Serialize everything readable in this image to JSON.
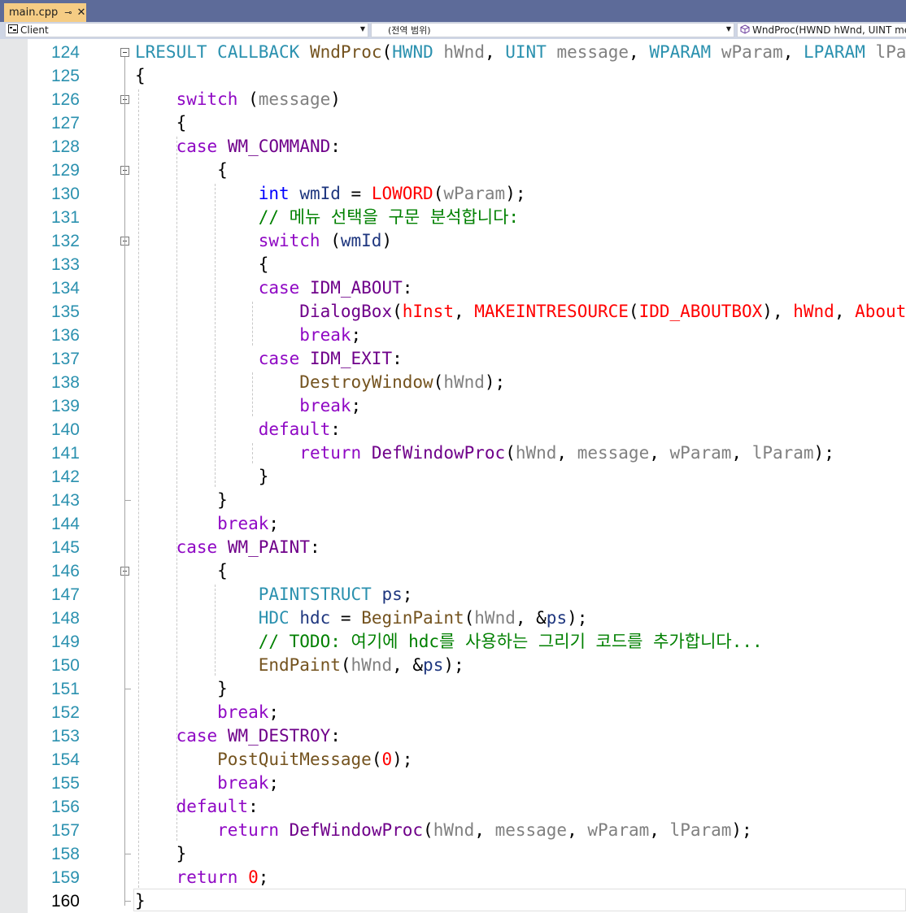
{
  "tab": {
    "title": "main.cpp",
    "pin_glyph": "⊸",
    "close_glyph": "✕"
  },
  "navbar": {
    "project": "Client",
    "scope": "(전역 범위)",
    "member": "WndProc(HWND hWnd, UINT mes"
  },
  "editor": {
    "current_line": 160,
    "lines": [
      {
        "n": 124,
        "tokens": [
          [
            "LRESULT",
            "type"
          ],
          [
            " ",
            ""
          ],
          [
            "CALLBACK",
            "type"
          ],
          [
            " ",
            ""
          ],
          [
            "WndProc",
            "fn"
          ],
          [
            "(",
            ""
          ],
          [
            "HWND",
            "type"
          ],
          [
            " ",
            ""
          ],
          [
            "hWnd",
            "param"
          ],
          [
            ", ",
            ""
          ],
          [
            "UINT",
            "type"
          ],
          [
            " ",
            ""
          ],
          [
            "message",
            "param"
          ],
          [
            ", ",
            ""
          ],
          [
            "WPARAM",
            "type"
          ],
          [
            " ",
            ""
          ],
          [
            "wParam",
            "param"
          ],
          [
            ", ",
            ""
          ],
          [
            "LPARAM",
            "type"
          ],
          [
            " ",
            ""
          ],
          [
            "lParam",
            "param"
          ],
          [
            ")",
            ""
          ]
        ]
      },
      {
        "n": 125,
        "tokens": [
          [
            "{",
            ""
          ]
        ]
      },
      {
        "n": 126,
        "tokens": [
          [
            "    ",
            ""
          ],
          [
            "switch",
            "kw"
          ],
          [
            " (",
            ""
          ],
          [
            "message",
            "param"
          ],
          [
            ")",
            ""
          ]
        ]
      },
      {
        "n": 127,
        "tokens": [
          [
            "    {",
            ""
          ]
        ]
      },
      {
        "n": 128,
        "tokens": [
          [
            "    ",
            ""
          ],
          [
            "case",
            "kw"
          ],
          [
            " ",
            ""
          ],
          [
            "WM_COMMAND",
            "macro"
          ],
          [
            ":",
            ""
          ]
        ]
      },
      {
        "n": 129,
        "tokens": [
          [
            "        {",
            ""
          ]
        ]
      },
      {
        "n": 130,
        "tokens": [
          [
            "            ",
            ""
          ],
          [
            "int",
            "blue"
          ],
          [
            " ",
            ""
          ],
          [
            "wmId",
            "var"
          ],
          [
            " = ",
            ""
          ],
          [
            "LOWORD",
            "red"
          ],
          [
            "(",
            ""
          ],
          [
            "wParam",
            "param"
          ],
          [
            ");",
            ""
          ]
        ]
      },
      {
        "n": 131,
        "tokens": [
          [
            "            ",
            ""
          ],
          [
            "// 메뉴 선택을 구문 분석합니다:",
            "comment"
          ]
        ]
      },
      {
        "n": 132,
        "tokens": [
          [
            "            ",
            ""
          ],
          [
            "switch",
            "kw"
          ],
          [
            " (",
            ""
          ],
          [
            "wmId",
            "var"
          ],
          [
            ")",
            ""
          ]
        ]
      },
      {
        "n": 133,
        "tokens": [
          [
            "            {",
            ""
          ]
        ]
      },
      {
        "n": 134,
        "tokens": [
          [
            "            ",
            ""
          ],
          [
            "case",
            "kw"
          ],
          [
            " ",
            ""
          ],
          [
            "IDM_ABOUT",
            "macro"
          ],
          [
            ":",
            ""
          ]
        ]
      },
      {
        "n": 135,
        "tokens": [
          [
            "                ",
            ""
          ],
          [
            "DialogBox",
            "macro"
          ],
          [
            "(",
            ""
          ],
          [
            "hInst",
            "red"
          ],
          [
            ", ",
            ""
          ],
          [
            "MAKEINTRESOURCE",
            "red"
          ],
          [
            "(",
            ""
          ],
          [
            "IDD_ABOUTBOX",
            "red"
          ],
          [
            "), ",
            ""
          ],
          [
            "hWnd",
            "red"
          ],
          [
            ", ",
            ""
          ],
          [
            "About",
            "red"
          ],
          [
            ");",
            ""
          ]
        ]
      },
      {
        "n": 136,
        "tokens": [
          [
            "                ",
            ""
          ],
          [
            "break",
            "kw"
          ],
          [
            ";",
            ""
          ]
        ]
      },
      {
        "n": 137,
        "tokens": [
          [
            "            ",
            ""
          ],
          [
            "case",
            "kw"
          ],
          [
            " ",
            ""
          ],
          [
            "IDM_EXIT",
            "macro"
          ],
          [
            ":",
            ""
          ]
        ]
      },
      {
        "n": 138,
        "tokens": [
          [
            "                ",
            ""
          ],
          [
            "DestroyWindow",
            "fn"
          ],
          [
            "(",
            ""
          ],
          [
            "hWnd",
            "param"
          ],
          [
            ");",
            ""
          ]
        ]
      },
      {
        "n": 139,
        "tokens": [
          [
            "                ",
            ""
          ],
          [
            "break",
            "kw"
          ],
          [
            ";",
            ""
          ]
        ]
      },
      {
        "n": 140,
        "tokens": [
          [
            "            ",
            ""
          ],
          [
            "default",
            "kw"
          ],
          [
            ":",
            ""
          ]
        ]
      },
      {
        "n": 141,
        "tokens": [
          [
            "                ",
            ""
          ],
          [
            "return",
            "kw"
          ],
          [
            " ",
            ""
          ],
          [
            "DefWindowProc",
            "macro"
          ],
          [
            "(",
            ""
          ],
          [
            "hWnd",
            "param"
          ],
          [
            ", ",
            ""
          ],
          [
            "message",
            "param"
          ],
          [
            ", ",
            ""
          ],
          [
            "wParam",
            "param"
          ],
          [
            ", ",
            ""
          ],
          [
            "lParam",
            "param"
          ],
          [
            ");",
            ""
          ]
        ]
      },
      {
        "n": 142,
        "tokens": [
          [
            "            }",
            ""
          ]
        ]
      },
      {
        "n": 143,
        "tokens": [
          [
            "        }",
            ""
          ]
        ]
      },
      {
        "n": 144,
        "tokens": [
          [
            "        ",
            ""
          ],
          [
            "break",
            "kw"
          ],
          [
            ";",
            ""
          ]
        ]
      },
      {
        "n": 145,
        "tokens": [
          [
            "    ",
            ""
          ],
          [
            "case",
            "kw"
          ],
          [
            " ",
            ""
          ],
          [
            "WM_PAINT",
            "macro"
          ],
          [
            ":",
            ""
          ]
        ]
      },
      {
        "n": 146,
        "tokens": [
          [
            "        {",
            ""
          ]
        ]
      },
      {
        "n": 147,
        "tokens": [
          [
            "            ",
            ""
          ],
          [
            "PAINTSTRUCT",
            "type"
          ],
          [
            " ",
            ""
          ],
          [
            "ps",
            "var"
          ],
          [
            ";",
            ""
          ]
        ]
      },
      {
        "n": 148,
        "tokens": [
          [
            "            ",
            ""
          ],
          [
            "HDC",
            "type"
          ],
          [
            " ",
            ""
          ],
          [
            "hdc",
            "var"
          ],
          [
            " = ",
            ""
          ],
          [
            "BeginPaint",
            "fn"
          ],
          [
            "(",
            ""
          ],
          [
            "hWnd",
            "param"
          ],
          [
            ", &",
            ""
          ],
          [
            "ps",
            "var"
          ],
          [
            ");",
            ""
          ]
        ]
      },
      {
        "n": 149,
        "tokens": [
          [
            "            ",
            ""
          ],
          [
            "// TODO: 여기에 hdc를 사용하는 그리기 코드를 추가합니다...",
            "comment"
          ]
        ]
      },
      {
        "n": 150,
        "tokens": [
          [
            "            ",
            ""
          ],
          [
            "EndPaint",
            "fn"
          ],
          [
            "(",
            ""
          ],
          [
            "hWnd",
            "param"
          ],
          [
            ", &",
            ""
          ],
          [
            "ps",
            "var"
          ],
          [
            ");",
            ""
          ]
        ]
      },
      {
        "n": 151,
        "tokens": [
          [
            "        }",
            ""
          ]
        ]
      },
      {
        "n": 152,
        "tokens": [
          [
            "        ",
            ""
          ],
          [
            "break",
            "kw"
          ],
          [
            ";",
            ""
          ]
        ]
      },
      {
        "n": 153,
        "tokens": [
          [
            "    ",
            ""
          ],
          [
            "case",
            "kw"
          ],
          [
            " ",
            ""
          ],
          [
            "WM_DESTROY",
            "macro"
          ],
          [
            ":",
            ""
          ]
        ]
      },
      {
        "n": 154,
        "tokens": [
          [
            "        ",
            ""
          ],
          [
            "PostQuitMessage",
            "fn"
          ],
          [
            "(",
            ""
          ],
          [
            "0",
            "num"
          ],
          [
            ");",
            ""
          ]
        ]
      },
      {
        "n": 155,
        "tokens": [
          [
            "        ",
            ""
          ],
          [
            "break",
            "kw"
          ],
          [
            ";",
            ""
          ]
        ]
      },
      {
        "n": 156,
        "tokens": [
          [
            "    ",
            ""
          ],
          [
            "default",
            "kw"
          ],
          [
            ":",
            ""
          ]
        ]
      },
      {
        "n": 157,
        "tokens": [
          [
            "        ",
            ""
          ],
          [
            "return",
            "kw"
          ],
          [
            " ",
            ""
          ],
          [
            "DefWindowProc",
            "macro"
          ],
          [
            "(",
            ""
          ],
          [
            "hWnd",
            "param"
          ],
          [
            ", ",
            ""
          ],
          [
            "message",
            "param"
          ],
          [
            ", ",
            ""
          ],
          [
            "wParam",
            "param"
          ],
          [
            ", ",
            ""
          ],
          [
            "lParam",
            "param"
          ],
          [
            ");",
            ""
          ]
        ]
      },
      {
        "n": 158,
        "tokens": [
          [
            "    }",
            ""
          ]
        ]
      },
      {
        "n": 159,
        "tokens": [
          [
            "    ",
            ""
          ],
          [
            "return",
            "kw"
          ],
          [
            " ",
            ""
          ],
          [
            "0",
            "num"
          ],
          [
            ";",
            ""
          ]
        ]
      },
      {
        "n": 160,
        "tokens": [
          [
            "}",
            ""
          ]
        ]
      }
    ]
  }
}
